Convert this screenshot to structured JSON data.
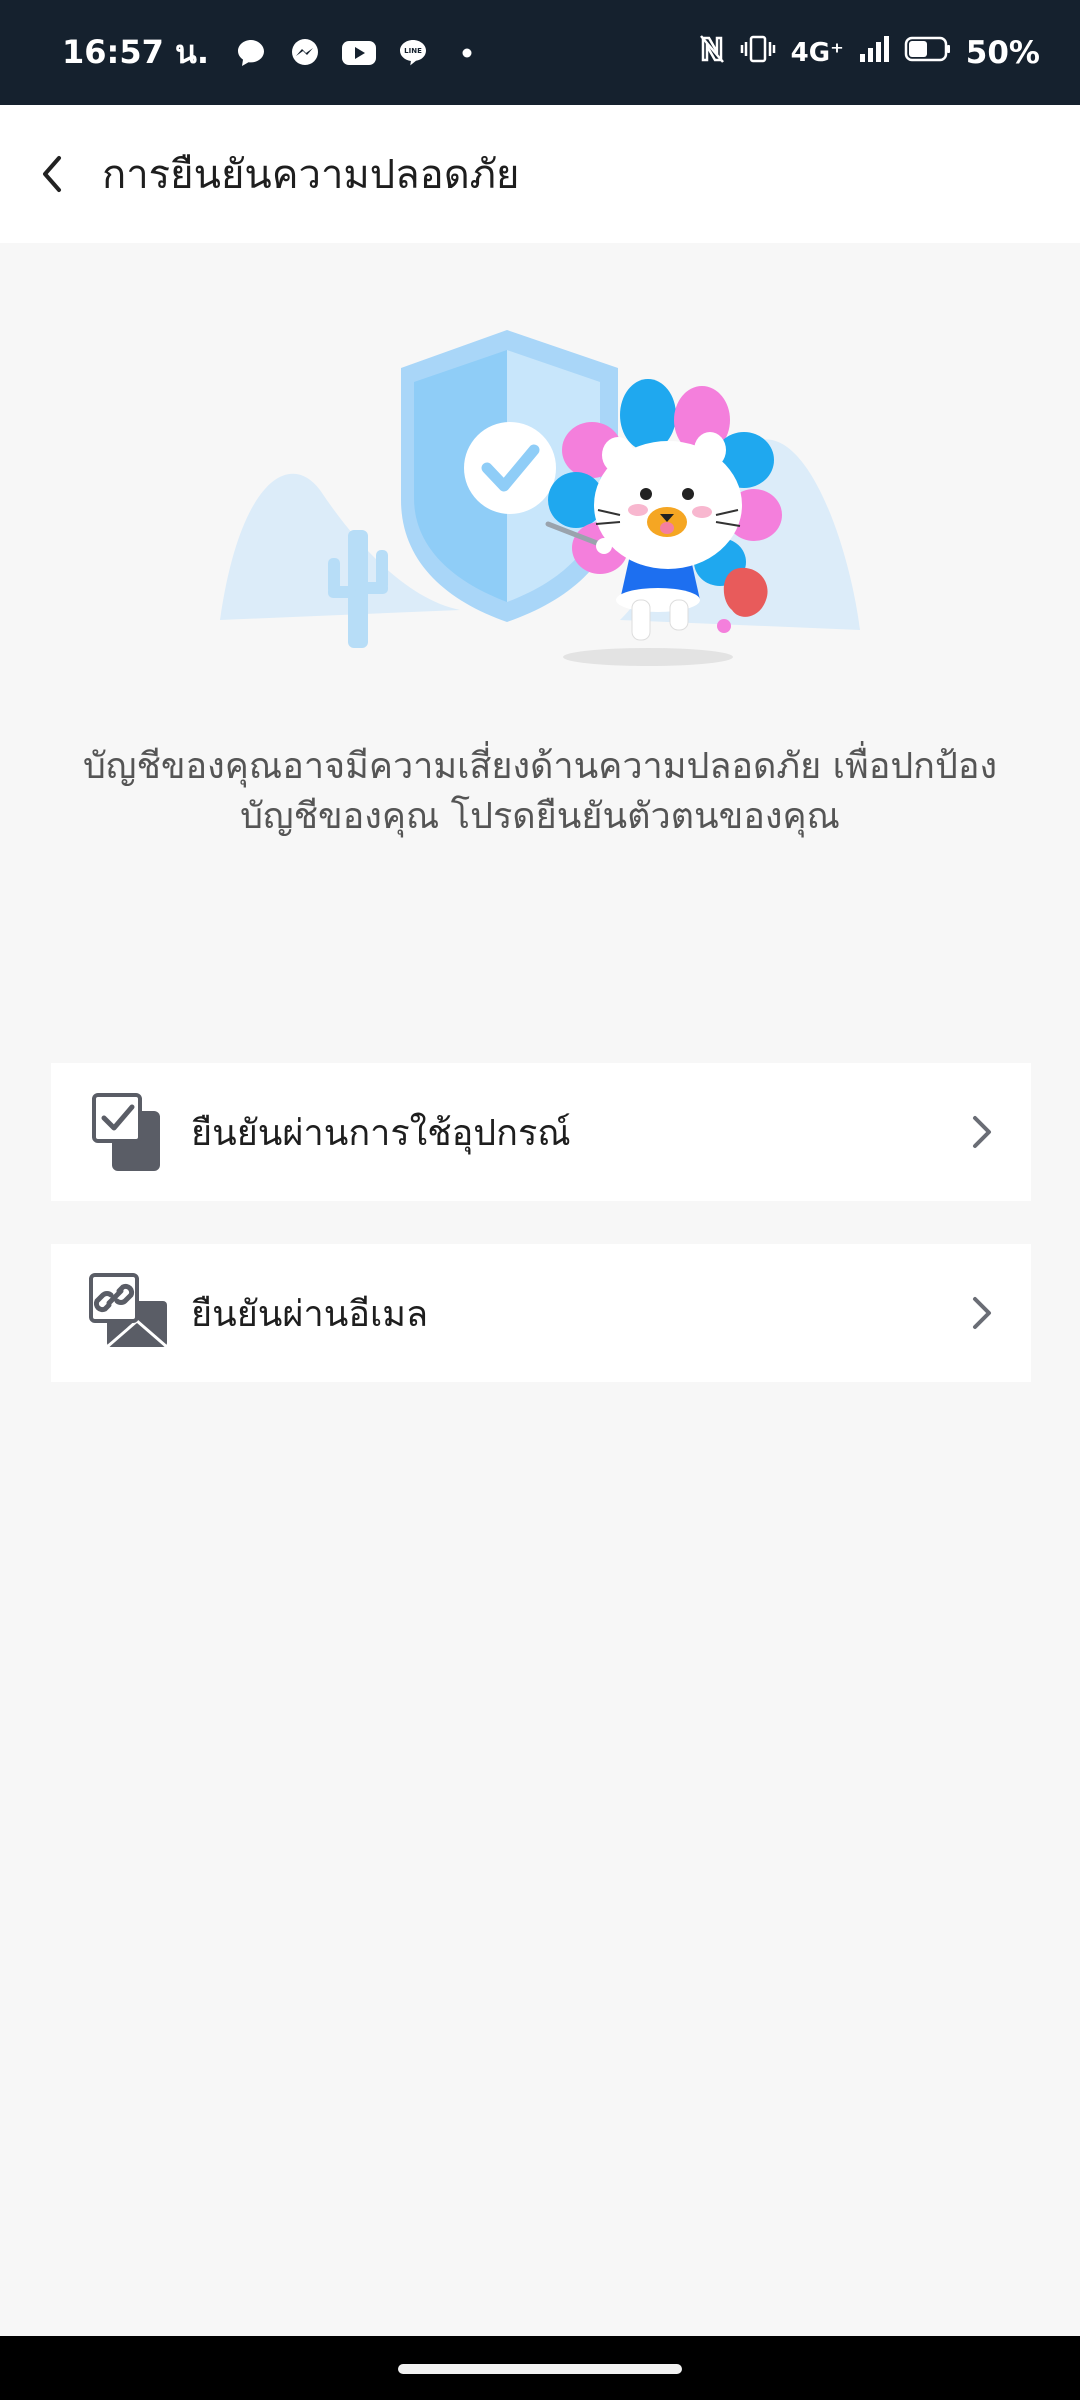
{
  "status_bar": {
    "time": "16:57 น.",
    "network": "4G⁺",
    "battery": "50%",
    "icons": [
      "chat-bubble-icon",
      "messenger-icon",
      "youtube-icon",
      "line-icon",
      "dot-icon",
      "nfc-icon",
      "vibrate-icon",
      "signal-icon",
      "battery-icon"
    ]
  },
  "header": {
    "title": "การยืนยันความปลอดภัย",
    "back_icon": "chevron-left-icon"
  },
  "illustration": {
    "icons": [
      "shield-check-icon",
      "cactus-icon",
      "mascot-character"
    ],
    "colors": {
      "shield": "#8fcdf7",
      "hills": "#dcecf9",
      "petal_blue": "#1fa8ef",
      "petal_pink": "#f47fdc",
      "shirt": "#1d6ff0"
    }
  },
  "description": "บัญชีของคุณอาจมีความเสี่ยงด้านความปลอดภัย เพื่อปกป้อง\nบัญชีของคุณ โปรดยืนยันตัวตนของคุณ",
  "options": [
    {
      "label": "ยืนยันผ่านการใช้อุปกรณ์",
      "icon": "device-check-icon"
    },
    {
      "label": "ยืนยันผ่านอีเมล",
      "icon": "email-link-icon"
    }
  ],
  "colors": {
    "status_bar_bg": "#15212e",
    "page_bg": "#f7f7f7",
    "card_bg": "#ffffff",
    "icon_gray": "#5a5d66"
  }
}
